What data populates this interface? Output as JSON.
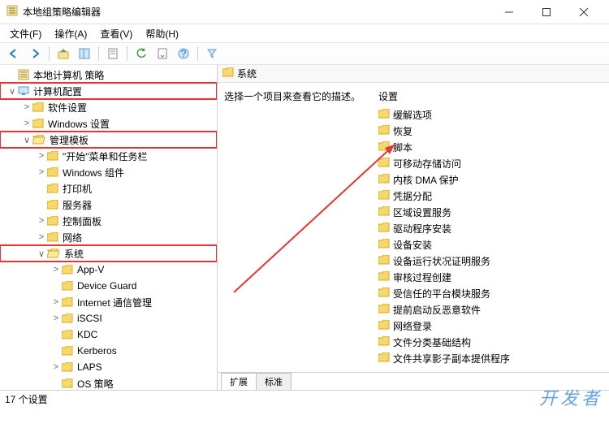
{
  "window": {
    "title": "本地组策略编辑器"
  },
  "menu": {
    "file": "文件(F)",
    "action": "操作(A)",
    "view": "查看(V)",
    "help": "帮助(H)"
  },
  "tree": {
    "root": "本地计算机 策略",
    "computer_config": "计算机配置",
    "software_settings": "软件设置",
    "windows_settings": "Windows 设置",
    "admin_templates": "管理模板",
    "start_taskbar": "\"开始\"菜单和任务栏",
    "windows_components": "Windows 组件",
    "printers": "打印机",
    "server": "服务器",
    "control_panel": "控制面板",
    "network": "网络",
    "system": "系统",
    "appv": "App-V",
    "device_guard": "Device Guard",
    "internet_comm": "Internet 通信管理",
    "iscsi": "iSCSI",
    "kdc": "KDC",
    "kerberos": "Kerberos",
    "laps": "LAPS",
    "os_policy": "OS 策略"
  },
  "right": {
    "header": "系统",
    "desc": "选择一个项目来查看它的描述。",
    "list_header": "设置",
    "items": [
      "缓解选项",
      "恢复",
      "脚本",
      "可移动存储访问",
      "内核 DMA 保护",
      "凭据分配",
      "区域设置服务",
      "驱动程序安装",
      "设备安装",
      "设备运行状况证明服务",
      "审核过程创建",
      "受信任的平台模块服务",
      "提前启动反恶意软件",
      "网络登录",
      "文件分类基础结构",
      "文件共享影子副本提供程序"
    ]
  },
  "tabs": {
    "extended": "扩展",
    "standard": "标准"
  },
  "status": "17 个设置",
  "watermark": "开发者"
}
